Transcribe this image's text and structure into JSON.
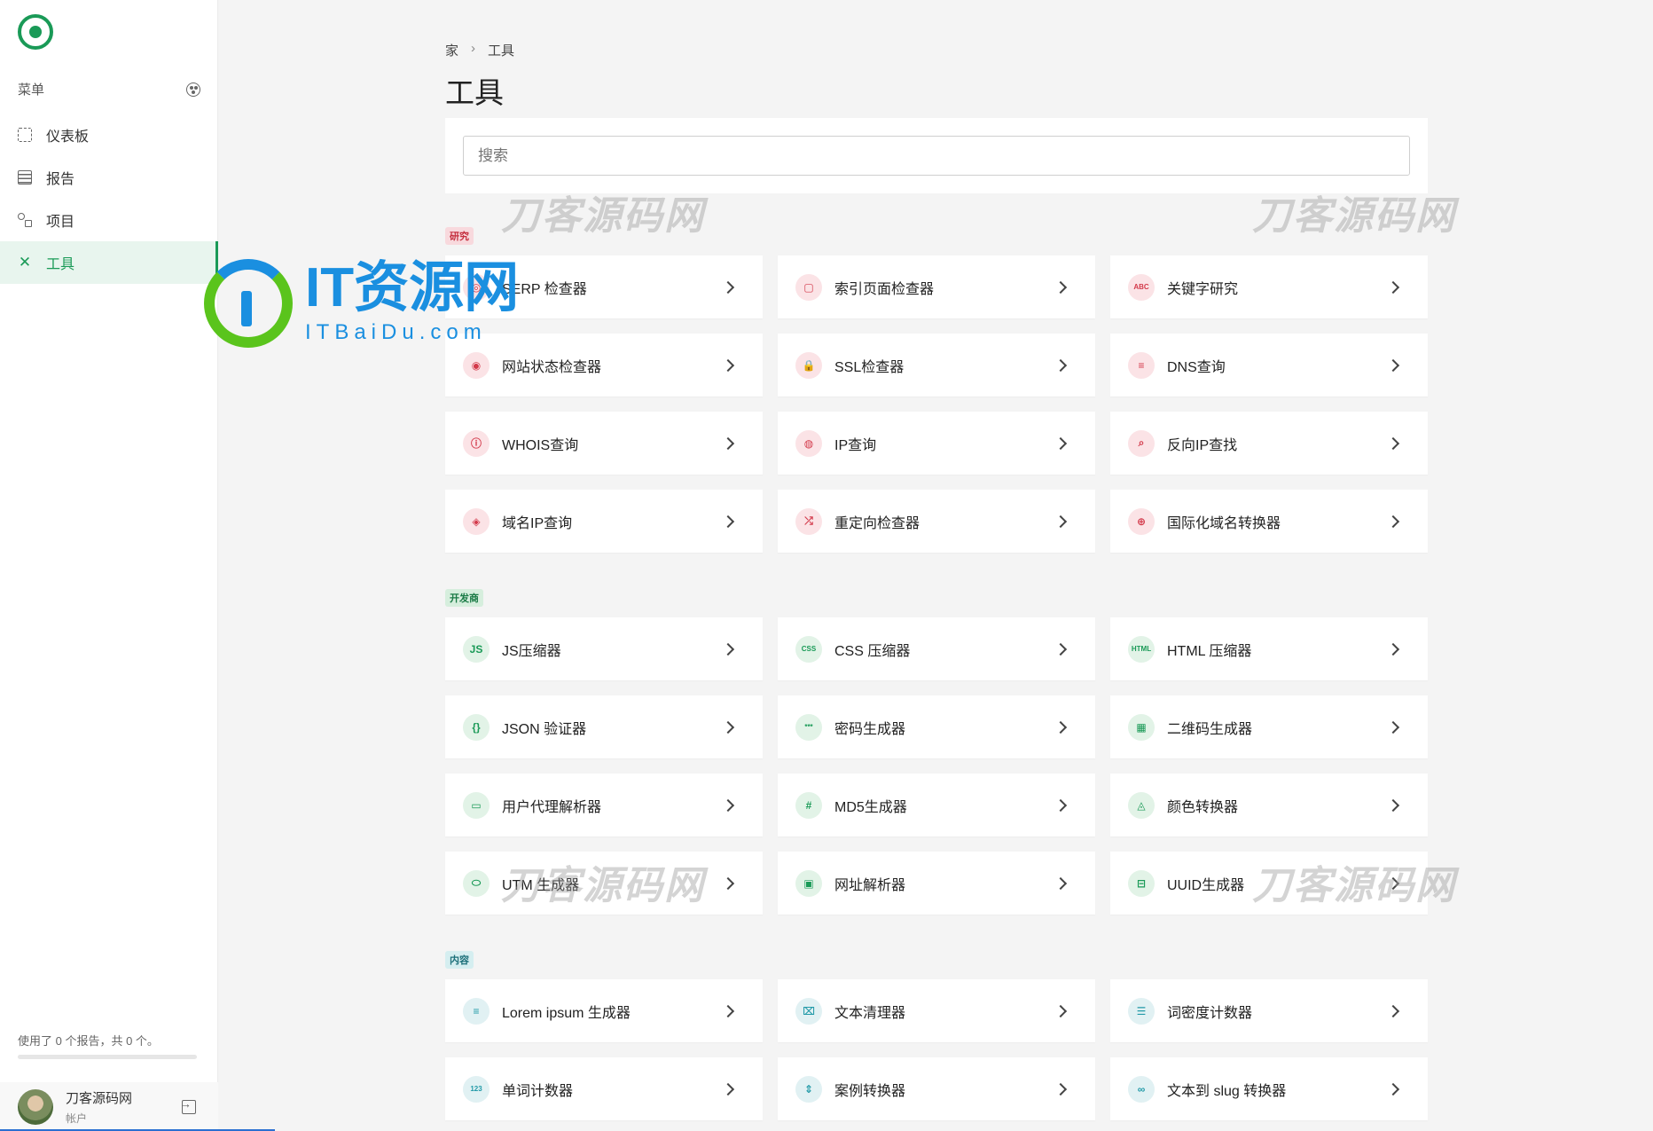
{
  "sidebar": {
    "menu_label": "菜单",
    "items": [
      {
        "label": "仪表板",
        "icon": "grid-icon",
        "active": false
      },
      {
        "label": "报告",
        "icon": "list-icon",
        "active": false
      },
      {
        "label": "项目",
        "icon": "tree-icon",
        "active": false
      },
      {
        "label": "工具",
        "icon": "tools-icon",
        "active": true
      }
    ],
    "usage_text": "使用了 0 个报告，共 0 个。",
    "account": {
      "name": "刀客源码网",
      "sub": "帐户"
    }
  },
  "breadcrumb": {
    "home": "家",
    "current": "工具"
  },
  "page_title": "工具",
  "search": {
    "placeholder": "搜索"
  },
  "sections": [
    {
      "tag": "研究",
      "color": "#c5303f",
      "tools": [
        {
          "label": "SERP 检查器",
          "icon": "serp-icon",
          "glyph": "◎"
        },
        {
          "label": "索引页面检查器",
          "icon": "index-page-icon",
          "glyph": "▢"
        },
        {
          "label": "关键字研究",
          "icon": "abc-icon",
          "glyph": "ABC"
        },
        {
          "label": "网站状态检查器",
          "icon": "signal-icon",
          "glyph": "◉"
        },
        {
          "label": "SSL检查器",
          "icon": "lock-icon",
          "glyph": "🔒"
        },
        {
          "label": "DNS查询",
          "icon": "server-icon",
          "glyph": "≡"
        },
        {
          "label": "WHOIS查询",
          "icon": "info-icon",
          "glyph": "ⓘ"
        },
        {
          "label": "IP查询",
          "icon": "ip-search-icon",
          "glyph": "◍"
        },
        {
          "label": "反向IP查找",
          "icon": "search-icon",
          "glyph": "⌕"
        },
        {
          "label": "域名IP查询",
          "icon": "target-icon",
          "glyph": "◈"
        },
        {
          "label": "重定向检查器",
          "icon": "shuffle-icon",
          "glyph": "⤮"
        },
        {
          "label": "国际化域名转换器",
          "icon": "globe-icon",
          "glyph": "⊕"
        }
      ]
    },
    {
      "tag": "开发商",
      "color": "#1a7a45",
      "tools": [
        {
          "label": "JS压缩器",
          "icon": "js-icon",
          "glyph": "JS"
        },
        {
          "label": "CSS 压缩器",
          "icon": "css-icon",
          "glyph": "CSS"
        },
        {
          "label": "HTML 压缩器",
          "icon": "html-icon",
          "glyph": "HTML"
        },
        {
          "label": "JSON 验证器",
          "icon": "braces-icon",
          "glyph": "{}"
        },
        {
          "label": "密码生成器",
          "icon": "password-icon",
          "glyph": "***"
        },
        {
          "label": "二维码生成器",
          "icon": "qr-code-icon",
          "glyph": "▦"
        },
        {
          "label": "用户代理解析器",
          "icon": "browser-icon",
          "glyph": "▭"
        },
        {
          "label": "MD5生成器",
          "icon": "hash-icon",
          "glyph": "#"
        },
        {
          "label": "颜色转换器",
          "icon": "palette-icon",
          "glyph": "◬"
        },
        {
          "label": "UTM 生成器",
          "icon": "tag-icon",
          "glyph": "⬭"
        },
        {
          "label": "网址解析器",
          "icon": "url-icon",
          "glyph": "▣"
        },
        {
          "label": "UUID生成器",
          "icon": "uuid-icon",
          "glyph": "⊟"
        }
      ]
    },
    {
      "tag": "内容",
      "color": "#1c6f79",
      "tools": [
        {
          "label": "Lorem ipsum 生成器",
          "icon": "lines-icon",
          "glyph": "≡"
        },
        {
          "label": "文本清理器",
          "icon": "clear-format-icon",
          "glyph": "⌧"
        },
        {
          "label": "词密度计数器",
          "icon": "list-density-icon",
          "glyph": "☰"
        },
        {
          "label": "单词计数器",
          "icon": "counter-icon",
          "glyph": "123"
        },
        {
          "label": "案例转换器",
          "icon": "case-icon",
          "glyph": "⇕"
        },
        {
          "label": "文本到 slug 转换器",
          "icon": "link-icon",
          "glyph": "∞"
        }
      ]
    }
  ],
  "watermarks": [
    "刀客源码网",
    "刀客源码网",
    "刀客源码网",
    "刀客源码网"
  ],
  "brand_overlay": {
    "main": "IT资源网",
    "sub": "ITBaiDu.com"
  }
}
